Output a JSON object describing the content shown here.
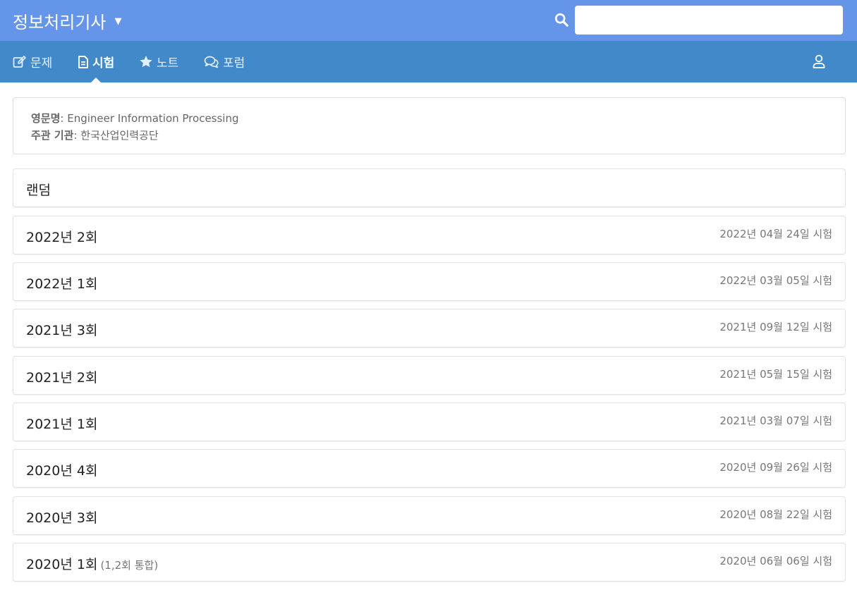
{
  "header": {
    "app_title": "정보처리기사",
    "dropdown_caret": "▼",
    "search": {
      "value": "",
      "placeholder": ""
    }
  },
  "nav": {
    "tabs": [
      {
        "label": "문제",
        "icon": "edit-icon"
      },
      {
        "label": "시험",
        "icon": "document-icon",
        "active": true
      },
      {
        "label": "노트",
        "icon": "star-icon"
      },
      {
        "label": "포럼",
        "icon": "chat-icon"
      }
    ],
    "user_icon": "user-icon"
  },
  "info": {
    "english_name_label": "영문명",
    "english_name": "Engineer Information Processing",
    "organizer_label": "주관 기관",
    "organizer": "한국산업인력공단",
    "separator": ": "
  },
  "exams": [
    {
      "title": "랜덤",
      "subtitle": "",
      "date": ""
    },
    {
      "title": "2022년 2회",
      "subtitle": "",
      "date": "2022년 04월 24일 시험"
    },
    {
      "title": "2022년 1회",
      "subtitle": "",
      "date": "2022년 03월 05일 시험"
    },
    {
      "title": "2021년 3회",
      "subtitle": "",
      "date": "2021년 09월 12일 시험"
    },
    {
      "title": "2021년 2회",
      "subtitle": "",
      "date": "2021년 05월 15일 시험"
    },
    {
      "title": "2021년 1회",
      "subtitle": "",
      "date": "2021년 03월 07일 시험"
    },
    {
      "title": "2020년 4회",
      "subtitle": "",
      "date": "2020년 09월 26일 시험"
    },
    {
      "title": "2020년 3회",
      "subtitle": "",
      "date": "2020년 08월 22일 시험"
    },
    {
      "title": "2020년 1회",
      "subtitle": "(1,2회 통합)",
      "date": "2020년 06월 06일 시험"
    }
  ],
  "colors": {
    "header_bg": "#6495e8",
    "nav_bg": "#4189c9"
  }
}
